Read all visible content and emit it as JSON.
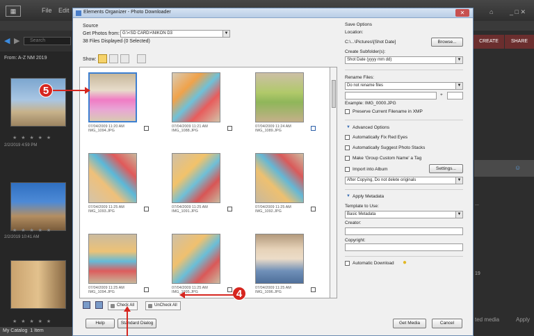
{
  "background": {
    "menu": [
      "File",
      "Edit"
    ],
    "search_placeholder": "Search",
    "left_header": "From: A-Z NM 2019",
    "dates": [
      "2/2/2019 4:59 PM",
      "2/2/2019 10:41 AM"
    ],
    "catalog": "My Catalog",
    "catalog_extra": "1 Item",
    "tabs": {
      "create": "CREATE",
      "share": "SHARE"
    },
    "right_texts": [
      "...",
      "19",
      "...",
      "ted media"
    ],
    "apply": "Apply",
    "win_controls": "_ □ ✕"
  },
  "dialog": {
    "title": "Elements Organizer - Photo Downloader",
    "close": "✕",
    "source": {
      "label": "Source",
      "get_photos_label": "Get Photos from:",
      "get_photos_value": "G:\\<SD CARD>\\NIKON D3",
      "files_displayed": "38 Files Displayed (0 Selected)"
    },
    "show_label": "Show:",
    "photos": [
      {
        "date": "07/04/2009 11:20 AM",
        "name": "IMG_1094.JPG",
        "checked": false,
        "selected": true
      },
      {
        "date": "07/04/2009 11:21 AM",
        "name": "IMG_1088.JPG",
        "checked": false
      },
      {
        "date": "07/04/2009 11:24 AM",
        "name": "IMG_1089.JPG",
        "checked": true
      },
      {
        "date": "07/04/2009 11:25 AM",
        "name": "IMG_1093.JPG",
        "checked": false
      },
      {
        "date": "07/04/2009 11:25 AM",
        "name": "IMG_1091.JPG",
        "checked": false
      },
      {
        "date": "07/04/2009 11:25 AM",
        "name": "IMG_1092.JPG",
        "checked": false
      },
      {
        "date": "07/04/2009 11:25 AM",
        "name": "IMG_1094.JPG",
        "checked": false
      },
      {
        "date": "07/04/2009 11:25 AM",
        "name": "IMG_1095.JPG",
        "checked": false
      },
      {
        "date": "07/04/2009 11:25 AM",
        "name": "IMG_1096.JPG",
        "checked": false
      }
    ],
    "check_all": "Check All",
    "uncheck_all": "UnCheck All",
    "help": "Help",
    "standard_dialog": "Standard Dialog",
    "get_media": "Get Media",
    "cancel": "Cancel",
    "options": {
      "save_options": "Save Options",
      "location_label": "Location:",
      "location_value": "C:\\...\\Pictures\\[Shot Date]",
      "browse": "Browse...",
      "create_subfolders_label": "Create Subfolder(s):",
      "create_subfolders_value": "Shot Date (yyyy mm dd)",
      "rename_files_label": "Rename Files:",
      "rename_files_value": "Do not rename files",
      "plus": "+",
      "example": "Example: IMG_0000.JPG",
      "preserve": "Preserve Current Filename in XMP",
      "advanced": "Advanced Options",
      "auto_red_eye": "Automatically Fix Red Eyes",
      "auto_stacks": "Automatically Suggest Photo Stacks",
      "make_group": "Make 'Group Custom Name' a Tag",
      "import_album": "Import into Album",
      "settings": "Settings...",
      "after_copying": "After Copying, Do not delete originals",
      "apply_metadata": "Apply Metadata",
      "template_label": "Template to Use:",
      "template_value": "Basic Metadata",
      "creator_label": "Creator:",
      "copyright_label": "Copyright:",
      "auto_download": "Automatic Download"
    }
  },
  "callouts": {
    "five": "5",
    "four": "4"
  },
  "colors": {
    "callout": "#d6261f",
    "selection": "#3c7fd1",
    "accent_tab": "#6b2e2e"
  }
}
